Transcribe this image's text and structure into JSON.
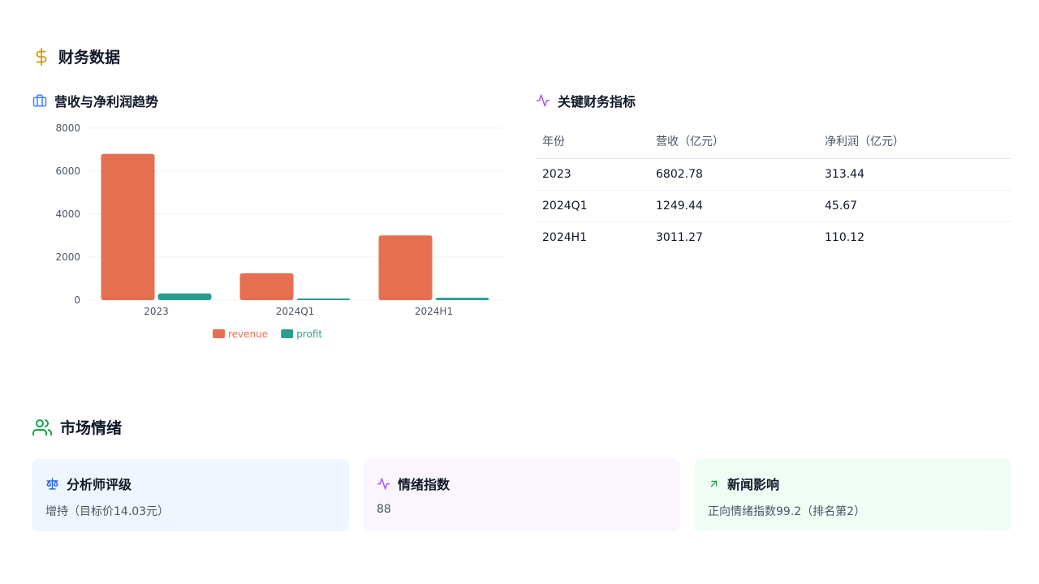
{
  "finance": {
    "title": "财务数据",
    "chart_title": "营收与净利润趋势",
    "table_title": "关键财务指标",
    "table": {
      "headers": [
        "年份",
        "营收（亿元）",
        "净利润（亿元）"
      ],
      "rows": [
        [
          "2023",
          "6802.78",
          "313.44"
        ],
        [
          "2024Q1",
          "1249.44",
          "45.67"
        ],
        [
          "2024H1",
          "3011.27",
          "110.12"
        ]
      ]
    }
  },
  "chart_data": {
    "type": "bar",
    "categories": [
      "2023",
      "2024Q1",
      "2024H1"
    ],
    "series": [
      {
        "name": "revenue",
        "values": [
          6802.78,
          1249.44,
          3011.27
        ],
        "color": "#e76f51"
      },
      {
        "name": "profit",
        "values": [
          313.44,
          45.67,
          110.12
        ],
        "color": "#2a9d8f"
      }
    ],
    "yticks": [
      0,
      2000,
      4000,
      6000,
      8000
    ],
    "ylim": [
      0,
      8000
    ],
    "grid": true,
    "legend": "bottom"
  },
  "sentiment": {
    "title": "市场情绪",
    "cards": [
      {
        "label": "分析师评级",
        "value": "增持（目标价14.03元）"
      },
      {
        "label": "情绪指数",
        "value": "88"
      },
      {
        "label": "新闻影响",
        "value": "正向情绪指数99.2（排名第2）"
      }
    ]
  },
  "colors": {
    "dollar_icon": "#d99a06",
    "briefcase_icon": "#3b82f6",
    "activity_icon": "#a855f7",
    "users_icon": "#16a34a",
    "scale_icon": "#2563eb",
    "arrow_icon": "#16a34a",
    "card_blue": "#eff6ff",
    "card_purple": "#faf5ff",
    "card_green": "#f0fdf4"
  }
}
